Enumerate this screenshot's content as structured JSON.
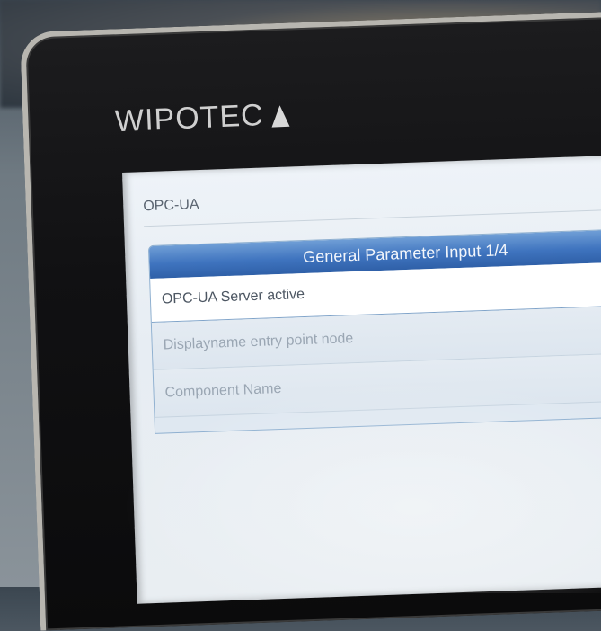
{
  "device": {
    "brand": "WIPOTEC"
  },
  "screen": {
    "module_title": "OPC-UA",
    "panel": {
      "header": "General Parameter Input 1/4",
      "rows": [
        {
          "label": "OPC-UA Server active",
          "active": true
        },
        {
          "label": "Displayname entry point node",
          "active": false
        },
        {
          "label": "Component Name",
          "active": false
        }
      ]
    }
  },
  "colors": {
    "accent": "#3f74bf",
    "screen_bg": "#eef3f8",
    "bezel": "#111113"
  }
}
